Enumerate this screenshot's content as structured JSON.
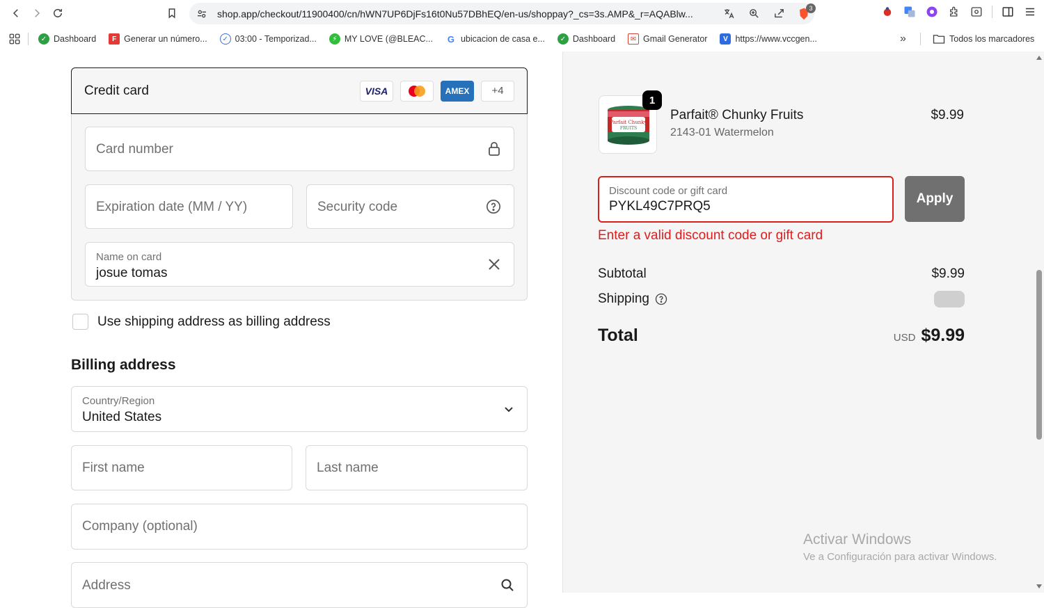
{
  "browser": {
    "url": "shop.app/checkout/11900400/cn/hWN7UP6DjFs16t0Nu57DBhEQ/en-us/shoppay?_cs=3s.AMP&_r=AQABlw...",
    "bookmarks": [
      {
        "label": "Dashboard",
        "icon": "dashboard-icon",
        "color": "#2ea043"
      },
      {
        "label": "Generar un número...",
        "icon": "f-icon",
        "color": "#e53935"
      },
      {
        "label": "03:00 - Temporizad...",
        "icon": "check-circle-icon",
        "color": "#3b6ed8"
      },
      {
        "label": "MY LOVE (@BLEAC...",
        "icon": "bolt-icon",
        "color": "#2fbf3c"
      },
      {
        "label": "ubicacion de casa e...",
        "icon": "google-icon",
        "color": "#4285f4"
      },
      {
        "label": "Dashboard",
        "icon": "dashboard-icon",
        "color": "#2ea043"
      },
      {
        "label": "Gmail Generator",
        "icon": "gmail-icon",
        "color": "#d44638"
      },
      {
        "label": "https://www.vccgen...",
        "icon": "v-icon",
        "color": "#2d6cdf"
      }
    ],
    "all_bookmarks_label": "Todos los marcadores",
    "shield_count": "3"
  },
  "payment": {
    "title": "Credit card",
    "cards": [
      "VISA",
      "",
      "AMEX",
      "+4"
    ],
    "card_number_placeholder": "Card number",
    "expiration_placeholder": "Expiration date (MM / YY)",
    "security_placeholder": "Security code",
    "name_label": "Name on card",
    "name_value": "josue tomas",
    "use_shipping_label": "Use shipping address as billing address"
  },
  "billing": {
    "title": "Billing address",
    "country_label": "Country/Region",
    "country_value": "United States",
    "first_name_placeholder": "First name",
    "last_name_placeholder": "Last name",
    "company_placeholder": "Company (optional)",
    "address_placeholder": "Address"
  },
  "summary": {
    "quantity": "1",
    "product_name": "Parfait® Chunky Fruits",
    "product_variant": "2143-01 Watermelon",
    "product_price": "$9.99",
    "discount_label": "Discount code or gift card",
    "discount_value": "PYKL49C7PRQ5",
    "apply_label": "Apply",
    "error_text": "Enter a valid discount code or gift card",
    "subtotal_label": "Subtotal",
    "subtotal_value": "$9.99",
    "shipping_label": "Shipping",
    "total_label": "Total",
    "currency": "USD",
    "total_value": "$9.99"
  },
  "watermark": {
    "line1": "Activar Windows",
    "line2": "Ve a Configuración para activar Windows."
  },
  "colors": {
    "error": "#dd1d1d",
    "apply_button": "#707070",
    "amex": "#2671b9"
  }
}
